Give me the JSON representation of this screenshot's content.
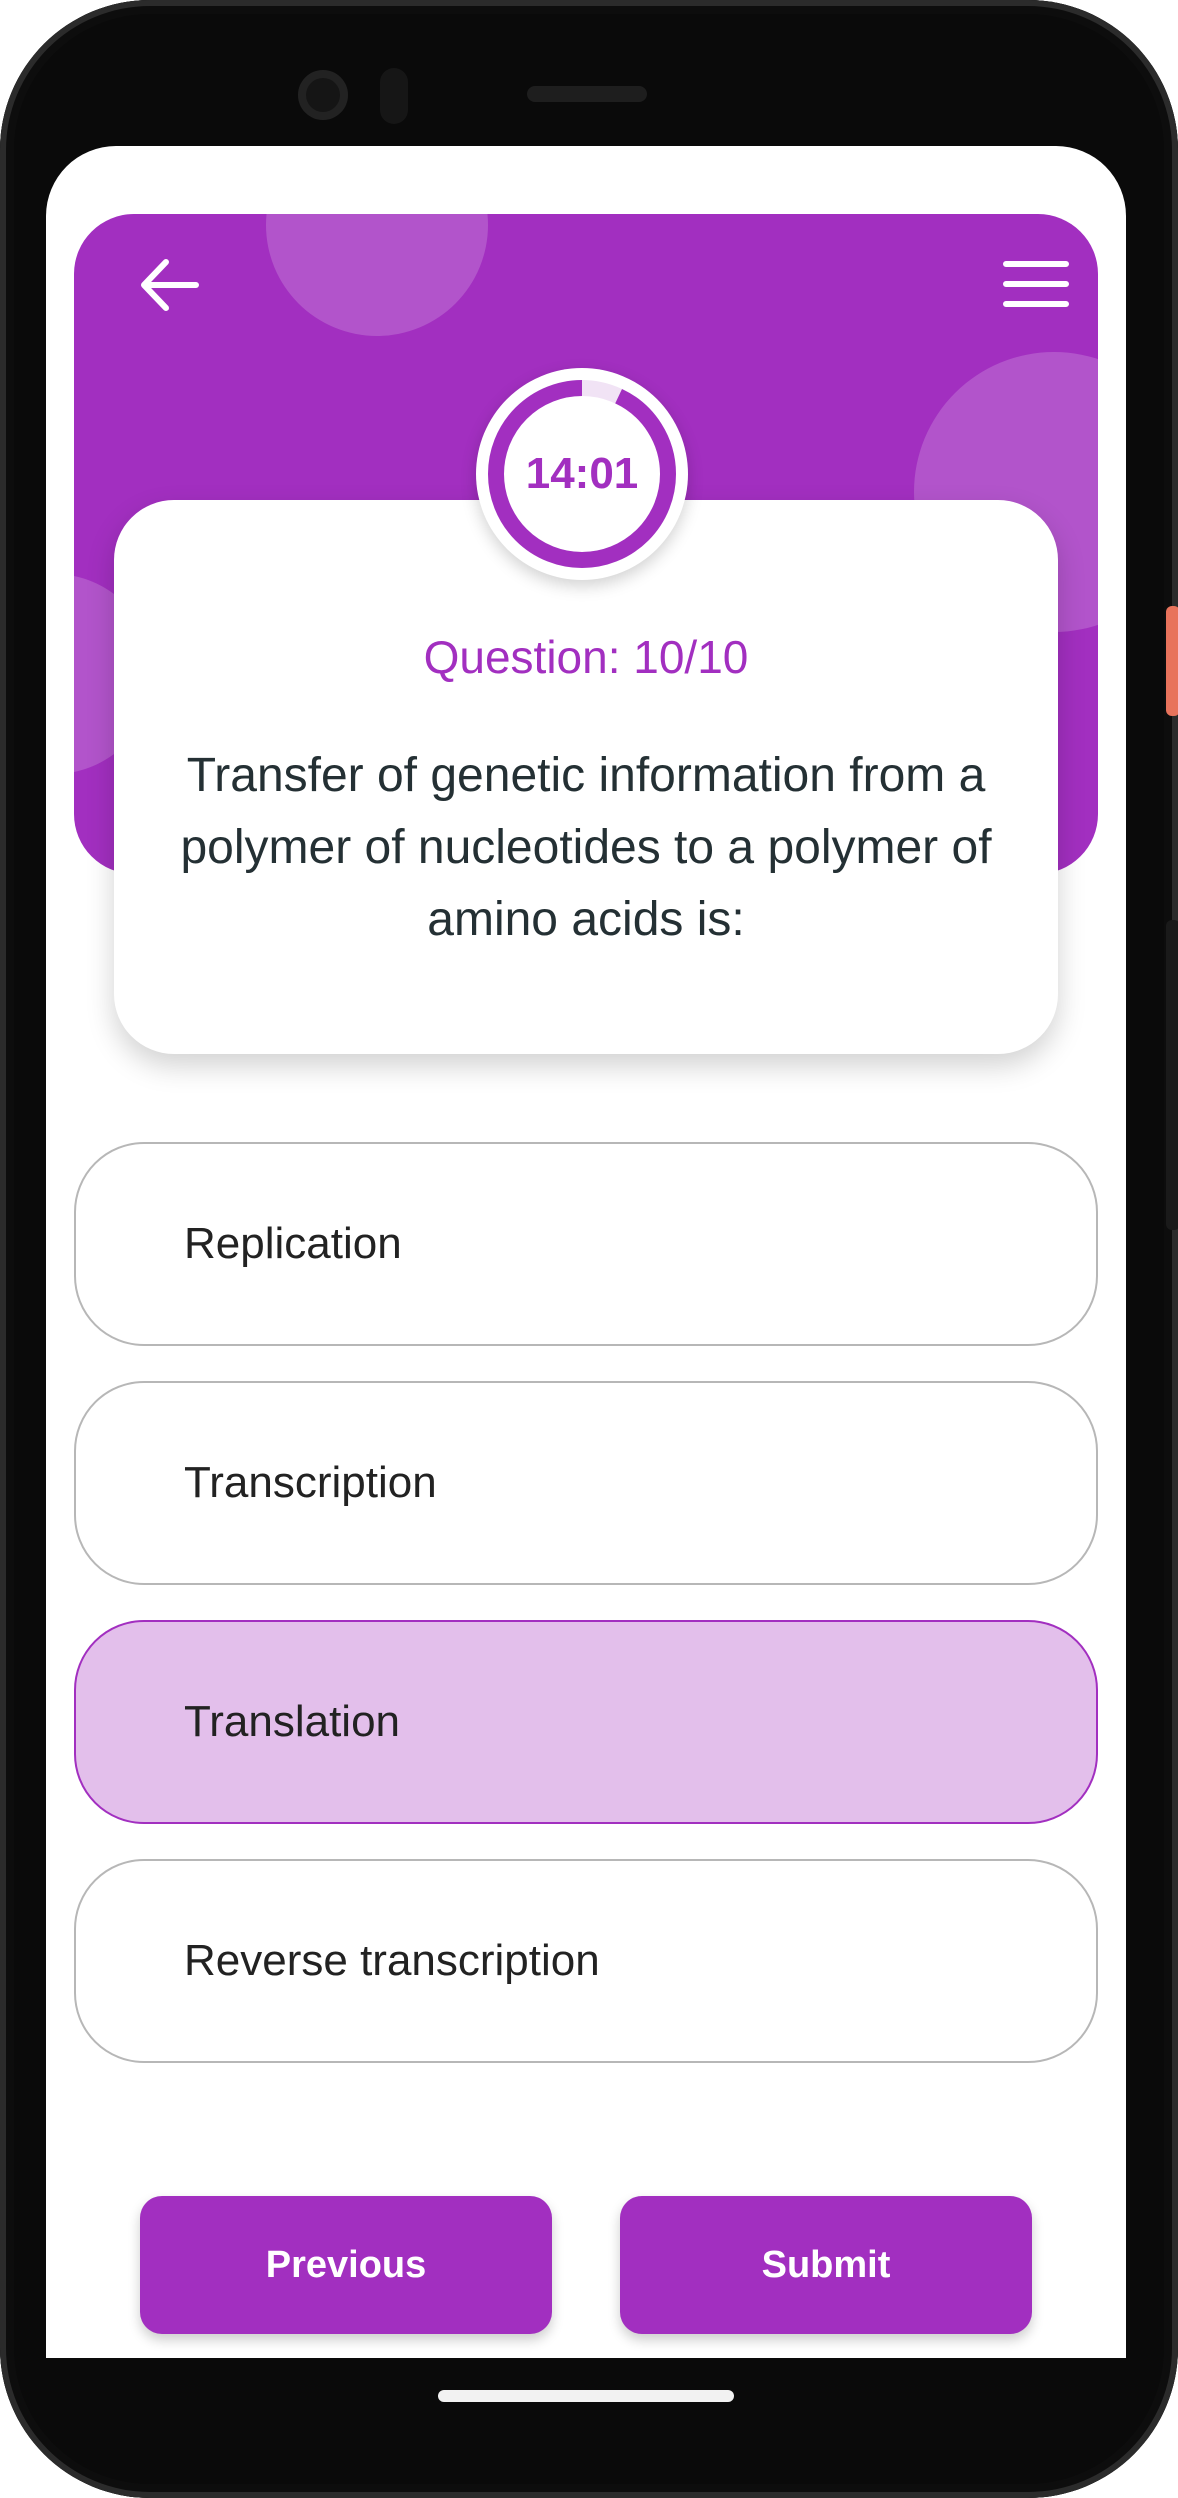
{
  "timer": {
    "value": "14:01",
    "progress_fraction": 0.93
  },
  "question": {
    "counter": "Question: 10/10",
    "text": "Transfer of genetic information from a polymer of nucleotides to a polymer of amino acids is:"
  },
  "options": [
    {
      "label": "Replication",
      "selected": false
    },
    {
      "label": "Transcription",
      "selected": false
    },
    {
      "label": "Translation",
      "selected": true
    },
    {
      "label": "Reverse transcription",
      "selected": false
    }
  ],
  "buttons": {
    "previous": "Previous",
    "submit": "Submit"
  },
  "icons": {
    "back": "arrow-left-icon",
    "menu": "hamburger-menu-icon"
  },
  "colors": {
    "accent": "#a22fc0",
    "selected_bg": "#e3bfeb",
    "text_dark": "#243034"
  }
}
